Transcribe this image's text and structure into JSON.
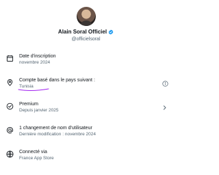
{
  "profile": {
    "name": "Alain Soral Officiel",
    "handle": "@officielsoral",
    "verified_color": "#1d9bf0"
  },
  "rows": [
    {
      "icon": "calendar-icon",
      "title": "Date d'inscription",
      "sub": "novembre 2024"
    },
    {
      "icon": "location-pin-icon",
      "title": "Compte basé dans le pays suivant :",
      "sub": "Tunisia",
      "trail": "info-icon"
    },
    {
      "icon": "premium-check-icon",
      "title": "Premium",
      "sub": "Depuis janvier 2025",
      "trail": "chevron-right-icon"
    },
    {
      "icon": "at-sign-icon",
      "title": "1 changement de nom d'utilisateur",
      "sub": "Dernière modification : novembre 2024"
    },
    {
      "icon": "globe-icon",
      "title": "Connecté via",
      "sub": "France App Store"
    }
  ],
  "colors": {
    "accent": "#1d9bf0",
    "secondary_text": "#536471",
    "highlight_stroke": "#a020f0"
  }
}
